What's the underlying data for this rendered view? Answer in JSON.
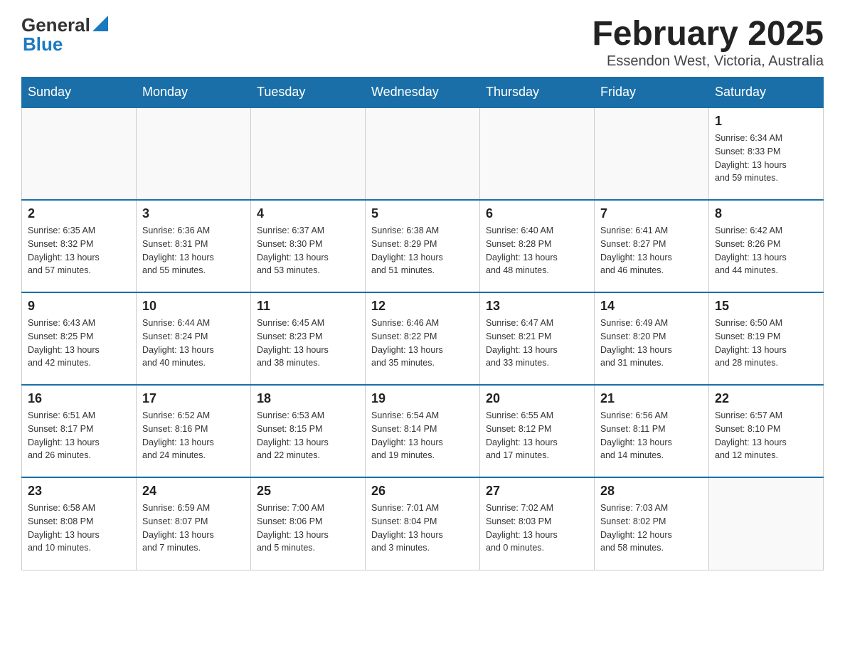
{
  "header": {
    "logo_general": "General",
    "logo_blue": "Blue",
    "title": "February 2025",
    "location": "Essendon West, Victoria, Australia"
  },
  "days_of_week": [
    "Sunday",
    "Monday",
    "Tuesday",
    "Wednesday",
    "Thursday",
    "Friday",
    "Saturday"
  ],
  "weeks": [
    {
      "days": [
        {
          "number": "",
          "info": ""
        },
        {
          "number": "",
          "info": ""
        },
        {
          "number": "",
          "info": ""
        },
        {
          "number": "",
          "info": ""
        },
        {
          "number": "",
          "info": ""
        },
        {
          "number": "",
          "info": ""
        },
        {
          "number": "1",
          "info": "Sunrise: 6:34 AM\nSunset: 8:33 PM\nDaylight: 13 hours\nand 59 minutes."
        }
      ]
    },
    {
      "days": [
        {
          "number": "2",
          "info": "Sunrise: 6:35 AM\nSunset: 8:32 PM\nDaylight: 13 hours\nand 57 minutes."
        },
        {
          "number": "3",
          "info": "Sunrise: 6:36 AM\nSunset: 8:31 PM\nDaylight: 13 hours\nand 55 minutes."
        },
        {
          "number": "4",
          "info": "Sunrise: 6:37 AM\nSunset: 8:30 PM\nDaylight: 13 hours\nand 53 minutes."
        },
        {
          "number": "5",
          "info": "Sunrise: 6:38 AM\nSunset: 8:29 PM\nDaylight: 13 hours\nand 51 minutes."
        },
        {
          "number": "6",
          "info": "Sunrise: 6:40 AM\nSunset: 8:28 PM\nDaylight: 13 hours\nand 48 minutes."
        },
        {
          "number": "7",
          "info": "Sunrise: 6:41 AM\nSunset: 8:27 PM\nDaylight: 13 hours\nand 46 minutes."
        },
        {
          "number": "8",
          "info": "Sunrise: 6:42 AM\nSunset: 8:26 PM\nDaylight: 13 hours\nand 44 minutes."
        }
      ]
    },
    {
      "days": [
        {
          "number": "9",
          "info": "Sunrise: 6:43 AM\nSunset: 8:25 PM\nDaylight: 13 hours\nand 42 minutes."
        },
        {
          "number": "10",
          "info": "Sunrise: 6:44 AM\nSunset: 8:24 PM\nDaylight: 13 hours\nand 40 minutes."
        },
        {
          "number": "11",
          "info": "Sunrise: 6:45 AM\nSunset: 8:23 PM\nDaylight: 13 hours\nand 38 minutes."
        },
        {
          "number": "12",
          "info": "Sunrise: 6:46 AM\nSunset: 8:22 PM\nDaylight: 13 hours\nand 35 minutes."
        },
        {
          "number": "13",
          "info": "Sunrise: 6:47 AM\nSunset: 8:21 PM\nDaylight: 13 hours\nand 33 minutes."
        },
        {
          "number": "14",
          "info": "Sunrise: 6:49 AM\nSunset: 8:20 PM\nDaylight: 13 hours\nand 31 minutes."
        },
        {
          "number": "15",
          "info": "Sunrise: 6:50 AM\nSunset: 8:19 PM\nDaylight: 13 hours\nand 28 minutes."
        }
      ]
    },
    {
      "days": [
        {
          "number": "16",
          "info": "Sunrise: 6:51 AM\nSunset: 8:17 PM\nDaylight: 13 hours\nand 26 minutes."
        },
        {
          "number": "17",
          "info": "Sunrise: 6:52 AM\nSunset: 8:16 PM\nDaylight: 13 hours\nand 24 minutes."
        },
        {
          "number": "18",
          "info": "Sunrise: 6:53 AM\nSunset: 8:15 PM\nDaylight: 13 hours\nand 22 minutes."
        },
        {
          "number": "19",
          "info": "Sunrise: 6:54 AM\nSunset: 8:14 PM\nDaylight: 13 hours\nand 19 minutes."
        },
        {
          "number": "20",
          "info": "Sunrise: 6:55 AM\nSunset: 8:12 PM\nDaylight: 13 hours\nand 17 minutes."
        },
        {
          "number": "21",
          "info": "Sunrise: 6:56 AM\nSunset: 8:11 PM\nDaylight: 13 hours\nand 14 minutes."
        },
        {
          "number": "22",
          "info": "Sunrise: 6:57 AM\nSunset: 8:10 PM\nDaylight: 13 hours\nand 12 minutes."
        }
      ]
    },
    {
      "days": [
        {
          "number": "23",
          "info": "Sunrise: 6:58 AM\nSunset: 8:08 PM\nDaylight: 13 hours\nand 10 minutes."
        },
        {
          "number": "24",
          "info": "Sunrise: 6:59 AM\nSunset: 8:07 PM\nDaylight: 13 hours\nand 7 minutes."
        },
        {
          "number": "25",
          "info": "Sunrise: 7:00 AM\nSunset: 8:06 PM\nDaylight: 13 hours\nand 5 minutes."
        },
        {
          "number": "26",
          "info": "Sunrise: 7:01 AM\nSunset: 8:04 PM\nDaylight: 13 hours\nand 3 minutes."
        },
        {
          "number": "27",
          "info": "Sunrise: 7:02 AM\nSunset: 8:03 PM\nDaylight: 13 hours\nand 0 minutes."
        },
        {
          "number": "28",
          "info": "Sunrise: 7:03 AM\nSunset: 8:02 PM\nDaylight: 12 hours\nand 58 minutes."
        },
        {
          "number": "",
          "info": ""
        }
      ]
    }
  ]
}
